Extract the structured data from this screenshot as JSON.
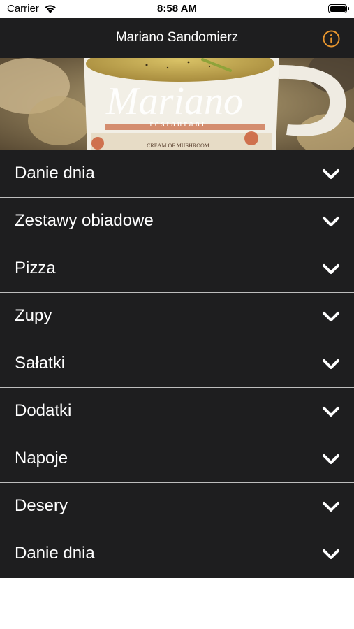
{
  "status_bar": {
    "carrier": "Carrier",
    "time": "8:58 AM"
  },
  "nav": {
    "title": "Mariano Sandomierz",
    "info_icon": "info-icon",
    "accent_color": "#e8962e"
  },
  "hero": {
    "logo_text": "Mariano",
    "logo_subtext": "restaurant",
    "cup_label": "CREAM OF MUSHROOM"
  },
  "menu": {
    "items": [
      {
        "label": "Danie dnia"
      },
      {
        "label": "Zestawy obiadowe"
      },
      {
        "label": "Pizza"
      },
      {
        "label": "Zupy"
      },
      {
        "label": "Sałatki"
      },
      {
        "label": "Dodatki"
      },
      {
        "label": "Napoje"
      },
      {
        "label": "Desery"
      },
      {
        "label": "Danie dnia"
      }
    ],
    "chevron_icon": "chevron-down-icon",
    "background": "#1e1e1f"
  }
}
